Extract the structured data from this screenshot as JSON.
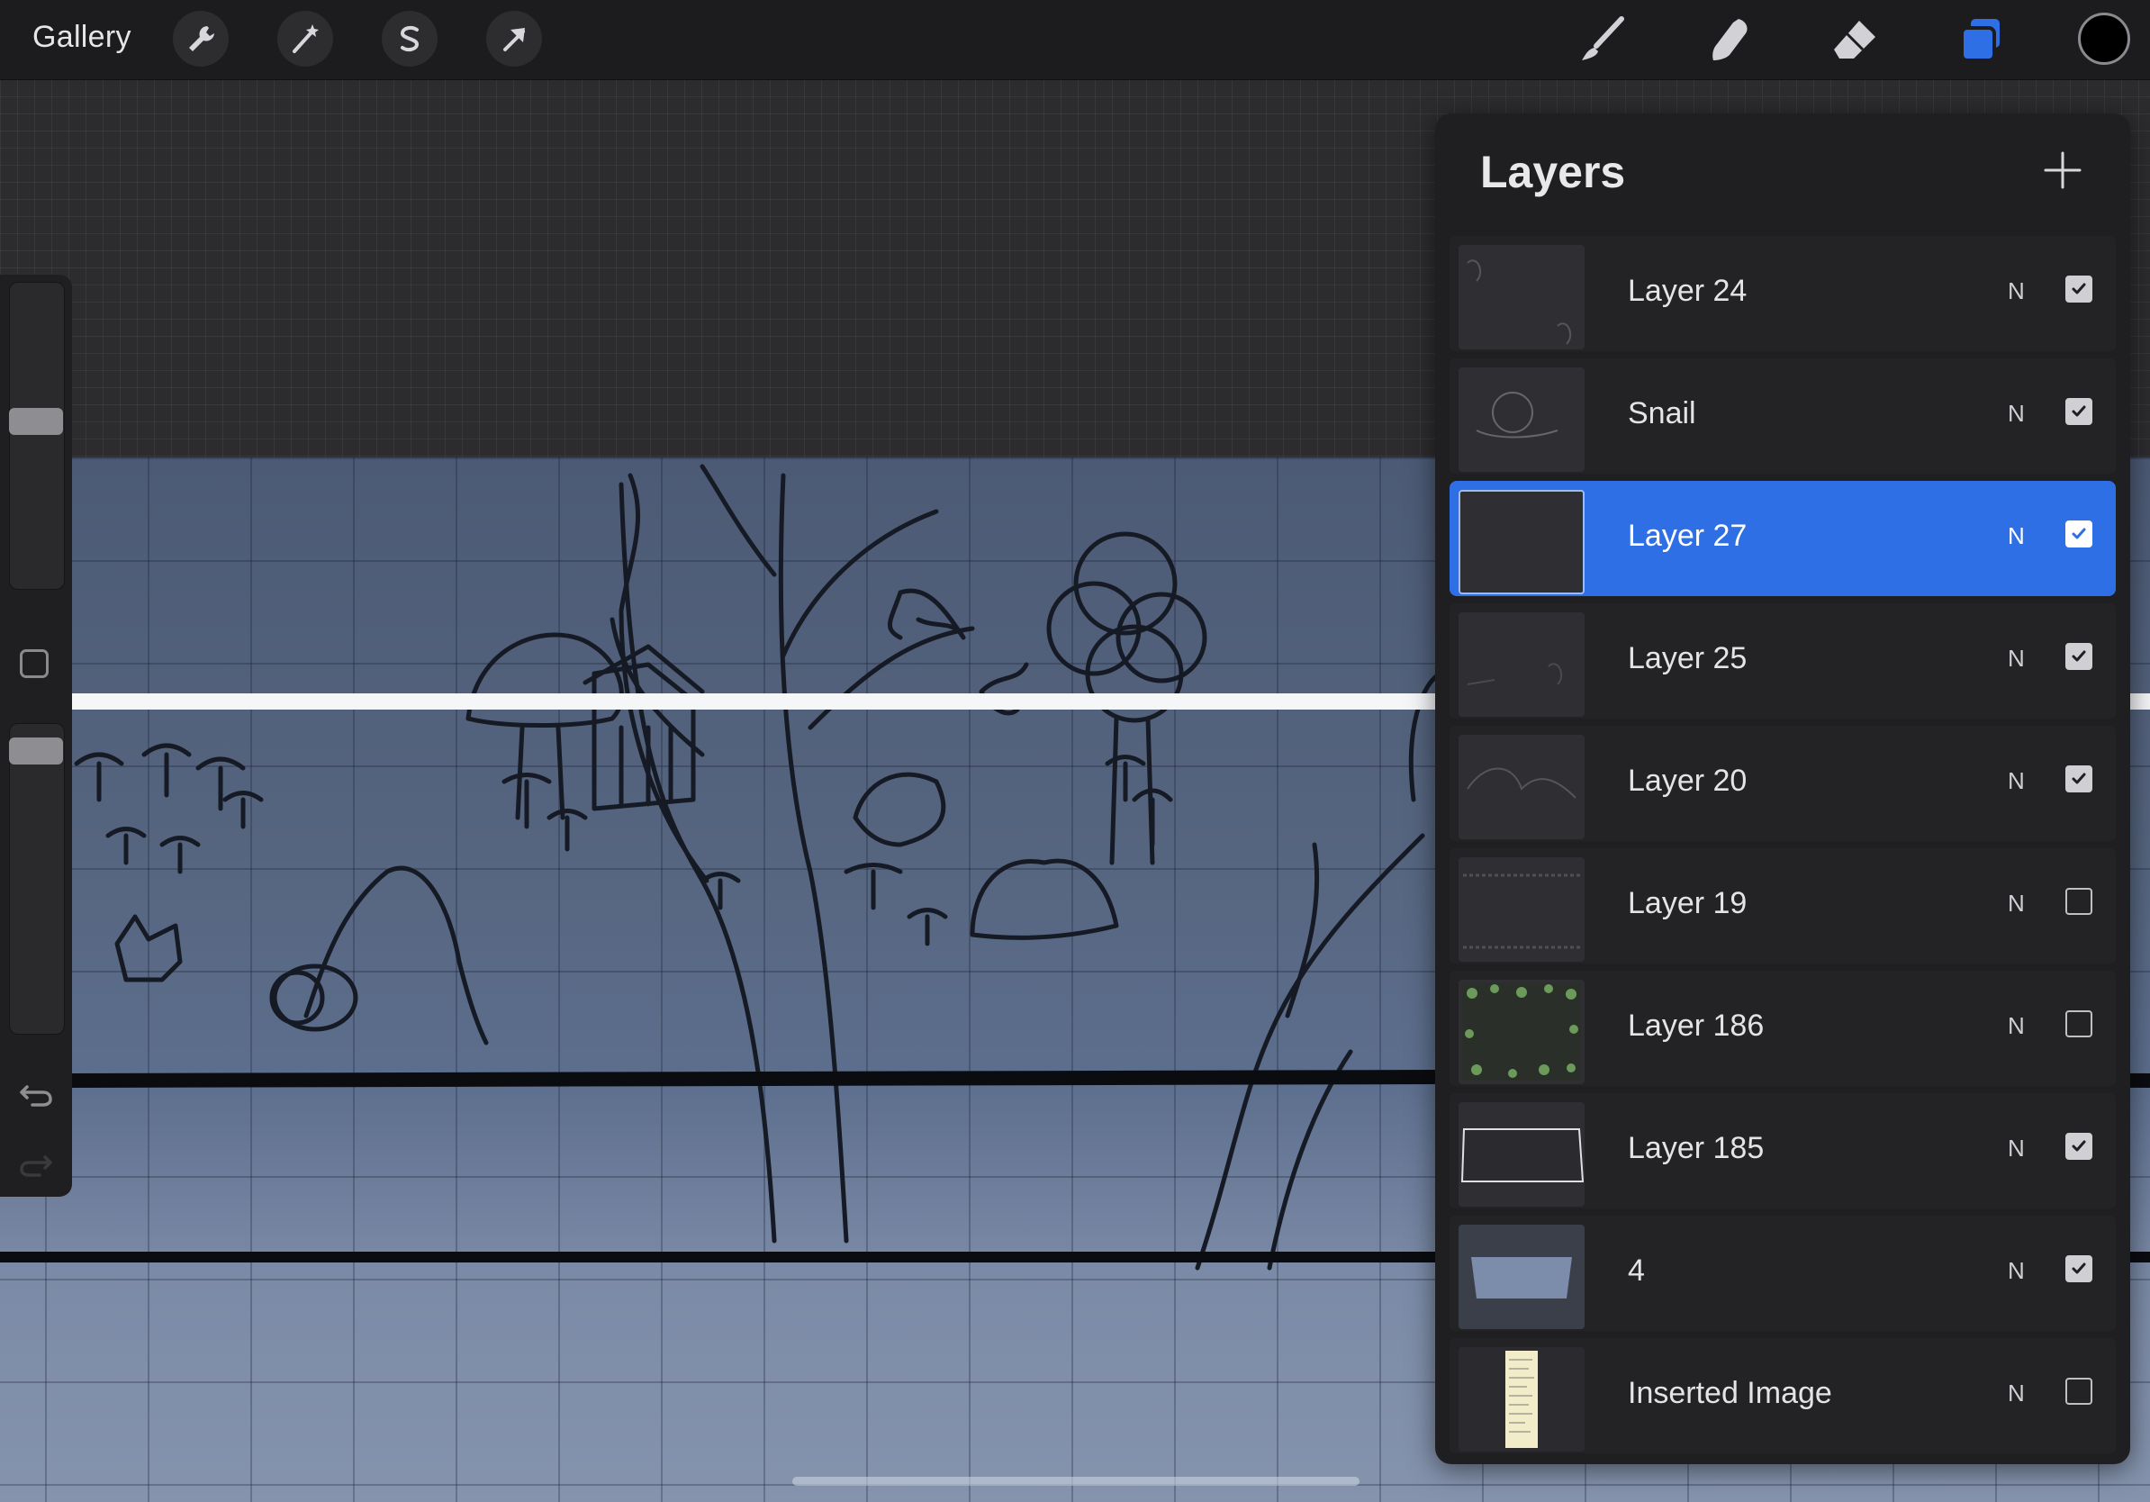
{
  "topbar": {
    "gallery_label": "Gallery",
    "left_tools": [
      {
        "name": "actions-wrench-icon"
      },
      {
        "name": "adjustments-magic-wand-icon"
      },
      {
        "name": "selection-s-icon"
      },
      {
        "name": "transform-arrow-icon"
      }
    ],
    "right_tools": [
      {
        "name": "brush-icon"
      },
      {
        "name": "smudge-icon"
      },
      {
        "name": "eraser-icon"
      },
      {
        "name": "layers-icon",
        "active": true
      }
    ],
    "color_swatch": "#000000",
    "accent_color": "#2f6fe6"
  },
  "sidebar": {
    "brush_size_level": 0.55,
    "opacity_level": 0.95
  },
  "layers_panel": {
    "title": "Layers",
    "add_icon": "plus-icon",
    "layers": [
      {
        "name": "Layer 24",
        "blend": "N",
        "visible": true,
        "selected": false
      },
      {
        "name": "Snail",
        "blend": "N",
        "visible": true,
        "selected": false
      },
      {
        "name": "Layer 27",
        "blend": "N",
        "visible": true,
        "selected": true
      },
      {
        "name": "Layer 25",
        "blend": "N",
        "visible": true,
        "selected": false
      },
      {
        "name": "Layer 20",
        "blend": "N",
        "visible": true,
        "selected": false
      },
      {
        "name": "Layer 19",
        "blend": "N",
        "visible": false,
        "selected": false
      },
      {
        "name": "Layer 186",
        "blend": "N",
        "visible": false,
        "selected": false
      },
      {
        "name": "Layer 185",
        "blend": "N",
        "visible": true,
        "selected": false
      },
      {
        "name": "4",
        "blend": "N",
        "visible": true,
        "selected": false
      },
      {
        "name": "Inserted Image",
        "blend": "N",
        "visible": false,
        "selected": false
      }
    ]
  }
}
